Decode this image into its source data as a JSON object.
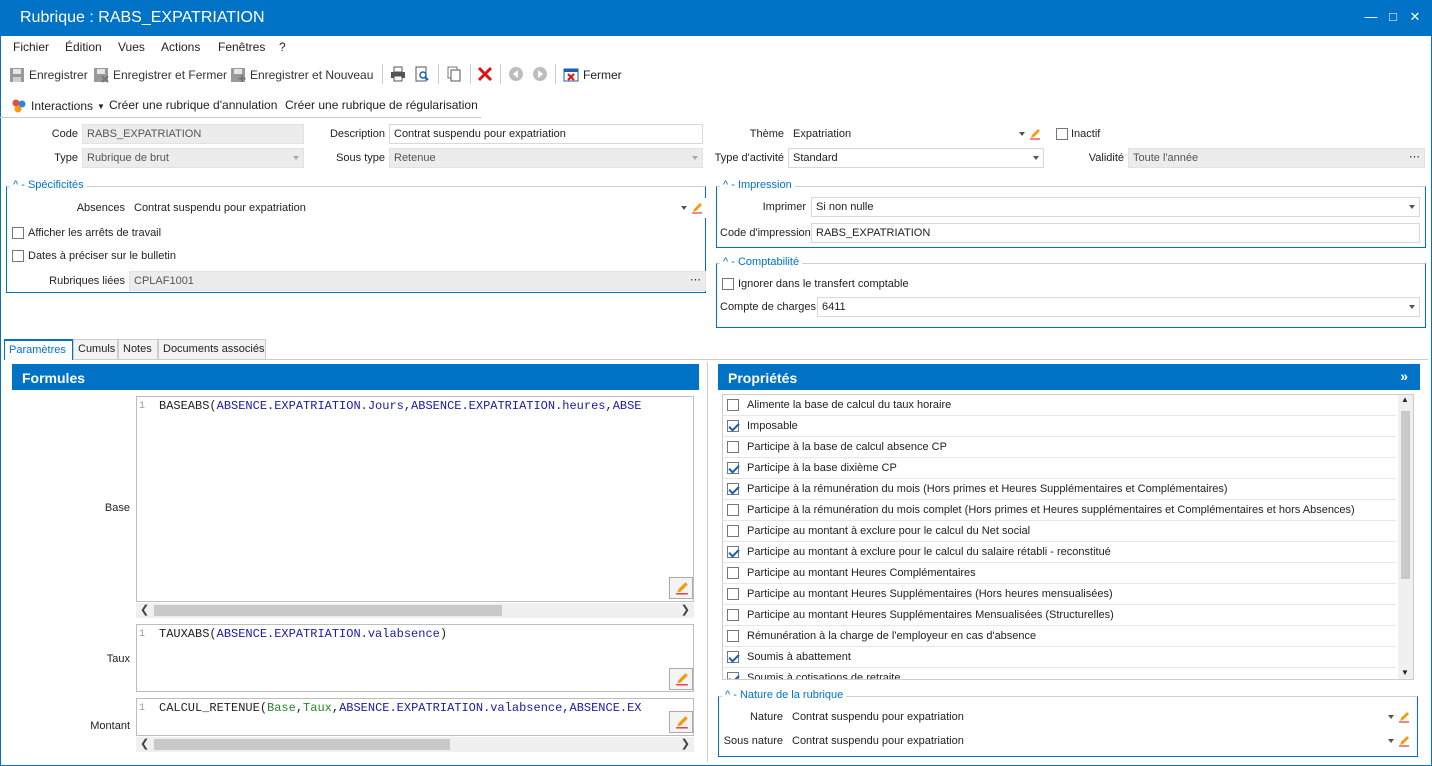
{
  "window": {
    "title": "Rubrique : RABS_EXPATRIATION"
  },
  "menu": [
    "Fichier",
    "Édition",
    "Vues",
    "Actions",
    "Fenêtres",
    "?"
  ],
  "toolbar": {
    "save": "Enregistrer",
    "save_close": "Enregistrer et Fermer",
    "save_new": "Enregistrer et Nouveau",
    "close": "Fermer"
  },
  "actions": {
    "interactions": "Interactions",
    "create_cancel": "Créer une rubrique d'annulation",
    "create_regul": "Créer une rubrique de régularisation"
  },
  "form": {
    "code_label": "Code",
    "code": "RABS_EXPATRIATION",
    "type_label": "Type",
    "type": "Rubrique de brut",
    "description_label": "Description",
    "description": "Contrat suspendu pour expatriation",
    "subtype_label": "Sous type",
    "subtype": "Retenue",
    "theme_label": "Thème",
    "theme": "Expatriation",
    "activity_label": "Type d'activité",
    "activity": "Standard",
    "inactive_label": "Inactif",
    "validity_label": "Validité",
    "validity": "Toute l'année"
  },
  "specificites": {
    "title": "Spécificités",
    "absences_label": "Absences",
    "absences": "Contrat suspendu pour expatriation",
    "show_stops": "Afficher les arrêts de travail",
    "dates": "Dates à préciser sur le bulletin",
    "linked_label": "Rubriques liées",
    "linked": "CPLAF1001"
  },
  "impression": {
    "title": "Impression",
    "print_label": "Imprimer",
    "print": "Si non nulle",
    "code_label": "Code d'impression",
    "code": "RABS_EXPATRIATION"
  },
  "comptabilite": {
    "title": "Comptabilité",
    "ignore": "Ignorer dans le transfert comptable",
    "account_label": "Compte de charges",
    "account": "6411"
  },
  "tabs": [
    "Paramètres",
    "Cumuls",
    "Notes",
    "Documents associés"
  ],
  "formules": {
    "title": "Formules",
    "base_label": "Base",
    "base_fn": "BASEABS",
    "base_args": "ABSENCE.EXPATRIATION.Jours,ABSENCE.EXPATRIATION.heures,ABSE",
    "taux_label": "Taux",
    "taux_fn": "TAUXABS",
    "taux_args": "ABSENCE.EXPATRIATION.valabsence",
    "montant_label": "Montant",
    "montant_fn": "CALCUL_RETENUE",
    "montant_g1": "Base",
    "montant_g2": "Taux",
    "montant_args": "ABSENCE.EXPATRIATION.valabsence,ABSENCE.EX",
    "line_no": "1"
  },
  "proprietes": {
    "title": "Propriétés",
    "items": [
      {
        "label": "Alimente la base de calcul du taux horaire",
        "checked": false
      },
      {
        "label": "Imposable",
        "checked": true
      },
      {
        "label": "Participe à la base de calcul absence CP",
        "checked": false
      },
      {
        "label": "Participe à la base dixième CP",
        "checked": true
      },
      {
        "label": "Participe à la rémunération du mois (Hors primes et Heures Supplémentaires et Complémentaires)",
        "checked": true
      },
      {
        "label": "Participe à la rémunération du mois complet (Hors primes et Heures supplémentaires et Complémentaires et hors Absences)",
        "checked": false
      },
      {
        "label": "Participe au montant à exclure pour le calcul du Net social",
        "checked": false
      },
      {
        "label": "Participe au montant à exclure pour le calcul du salaire rétabli - reconstitué",
        "checked": true
      },
      {
        "label": "Participe au montant Heures Complémentaires",
        "checked": false
      },
      {
        "label": "Participe au montant Heures Supplémentaires (Hors heures mensualisées)",
        "checked": false
      },
      {
        "label": "Participe au montant Heures Supplémentaires Mensualisées (Structurelles)",
        "checked": false
      },
      {
        "label": "Rémunération à la charge de l'employeur en cas d'absence",
        "checked": false
      },
      {
        "label": "Soumis à abattement",
        "checked": true
      },
      {
        "label": "Soumis à cotisations de retraite",
        "checked": true
      }
    ]
  },
  "nature": {
    "title": "Nature de la rubrique",
    "nature_label": "Nature",
    "nature": "Contrat suspendu pour expatriation",
    "subnature_label": "Sous nature",
    "subnature": "Contrat suspendu pour expatriation"
  }
}
